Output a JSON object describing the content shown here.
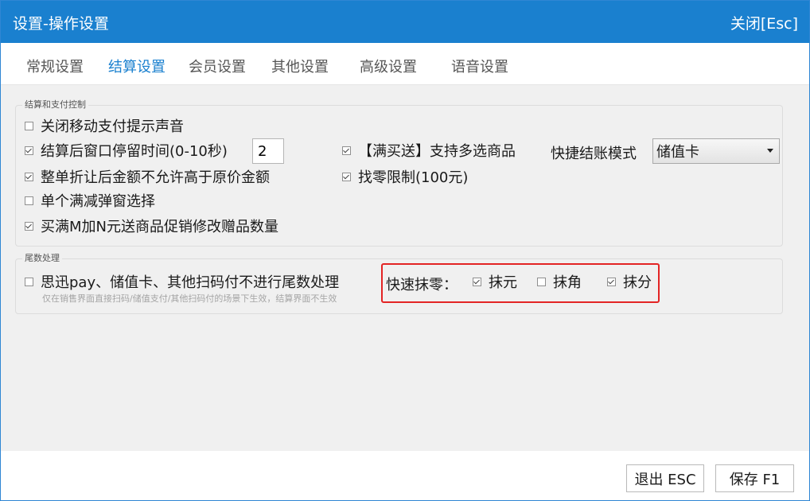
{
  "window": {
    "title": "设置-操作设置",
    "close_label": "关闭[Esc]"
  },
  "tabs": [
    {
      "label": "常规设置",
      "active": false
    },
    {
      "label": "结算设置",
      "active": true
    },
    {
      "label": "会员设置",
      "active": false
    },
    {
      "label": "其他设置",
      "active": false
    },
    {
      "label": "高级设置",
      "active": false
    },
    {
      "label": "语音设置",
      "active": false
    }
  ],
  "settlement_group": {
    "legend": "结算和支付控制",
    "options": {
      "close_mobile_pay_sound": {
        "label": "关闭移动支付提示声音",
        "checked": false
      },
      "stay_time": {
        "label": "结算后窗口停留时间(0-10秒)",
        "checked": true,
        "value": "2"
      },
      "no_exceed_original": {
        "label": "整单折让后金额不允许高于原价金额",
        "checked": true
      },
      "single_discount_popup": {
        "label": "单个满减弹窗选择",
        "checked": false
      },
      "buy_m_add_n": {
        "label": "买满M加N元送商品促销修改赠品数量",
        "checked": true
      },
      "multi_select_gift": {
        "label": "【满买送】支持多选商品",
        "checked": true
      },
      "change_limit": {
        "label": "找零限制(100元)",
        "checked": true
      }
    },
    "quick_checkout": {
      "label": "快捷结账模式",
      "selected": "储值卡"
    }
  },
  "rounding_group": {
    "legend": "尾数处理",
    "skip_rounding": {
      "label": "思迅pay、储值卡、其他扫码付不进行尾数处理",
      "checked": false
    },
    "hint": "仅在销售界面直接扫码/储值支付/其他扫码付的场景下生效，结算界面不生效",
    "quick_round": {
      "label": "快速抹零：",
      "yuan": {
        "label": "抹元",
        "checked": true
      },
      "jiao": {
        "label": "抹角",
        "checked": false
      },
      "fen": {
        "label": "抹分",
        "checked": true
      }
    }
  },
  "footer": {
    "exit_label": "退出 ESC",
    "save_label": "保存 F1"
  },
  "colors": {
    "accent": "#1a80cf",
    "highlight": "#e32424",
    "content_bg": "#f0f0f0"
  }
}
